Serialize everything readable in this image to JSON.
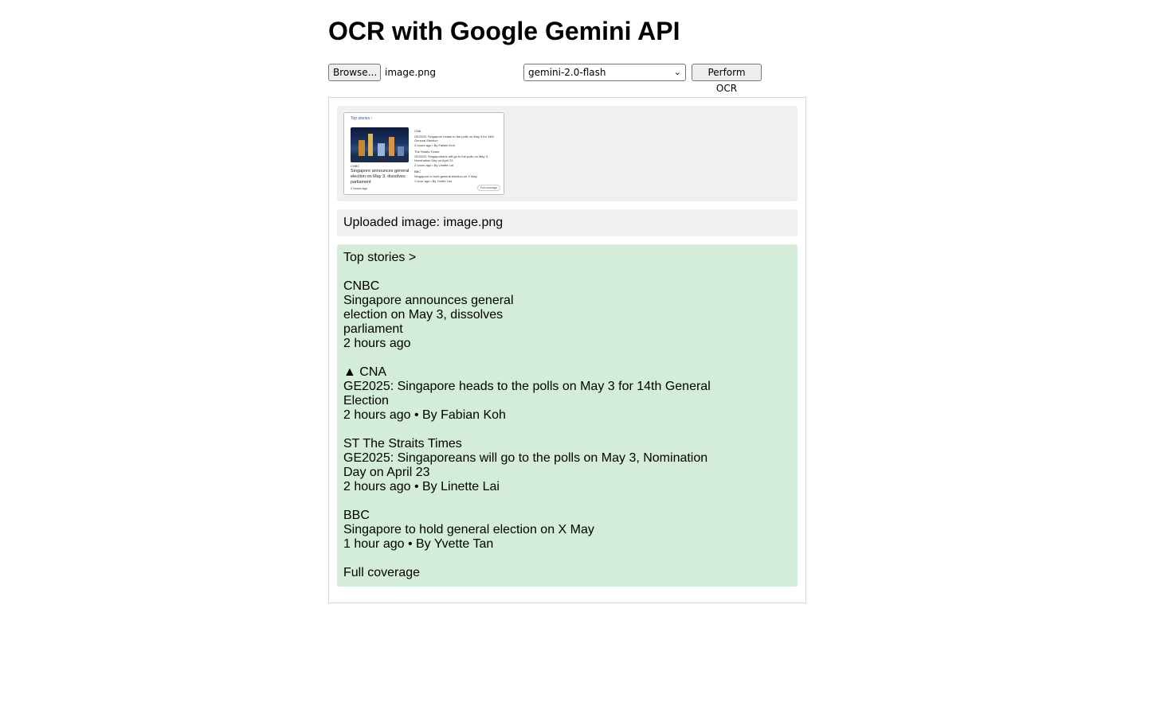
{
  "page_title": "OCR with Google Gemini API",
  "controls": {
    "browse_label": "Browse...",
    "file_name": "image.png",
    "model_selected": "gemini-2.0-flash",
    "ocr_button_label": "Perform OCR"
  },
  "thumbnail": {
    "title": "Top stories ›",
    "source_main": "CNBC",
    "headline_main": "Singapore announces general election on May 3, dissolves parliament",
    "time_main": "2 hours ago",
    "side_items": [
      "CNA",
      "GE2025: Singapore heads to the polls on May 3 for 14th General Election",
      "2 hours ago • By Fabian Koh",
      "The Straits Times",
      "GE2025: Singaporeans will go to the polls on May 3, Nomination Day on April 23",
      "2 hours ago • By Linette Lai",
      "BBC",
      "Singapore to hold general election on X May",
      "1 hour ago • By Yvette Tan"
    ],
    "full_coverage": "Full coverage"
  },
  "uploaded_text": "Uploaded image: image.png",
  "ocr_result": {
    "lines": [
      "Top stories >",
      "",
      "CNBC",
      "Singapore announces general",
      "election on May 3, dissolves",
      "parliament",
      "2 hours ago",
      "",
      "▲ CNA",
      "GE2025: Singapore heads to the polls on May 3 for 14th General",
      "Election",
      "2 hours ago • By Fabian Koh",
      "",
      "ST The Straits Times",
      "GE2025: Singaporeans will go to the polls on May 3, Nomination",
      "Day on April 23",
      "2 hours ago • By Linette Lai",
      "",
      "BBC",
      "Singapore to hold general election on X May",
      "1 hour ago • By Yvette Tan",
      "",
      "Full coverage"
    ]
  }
}
